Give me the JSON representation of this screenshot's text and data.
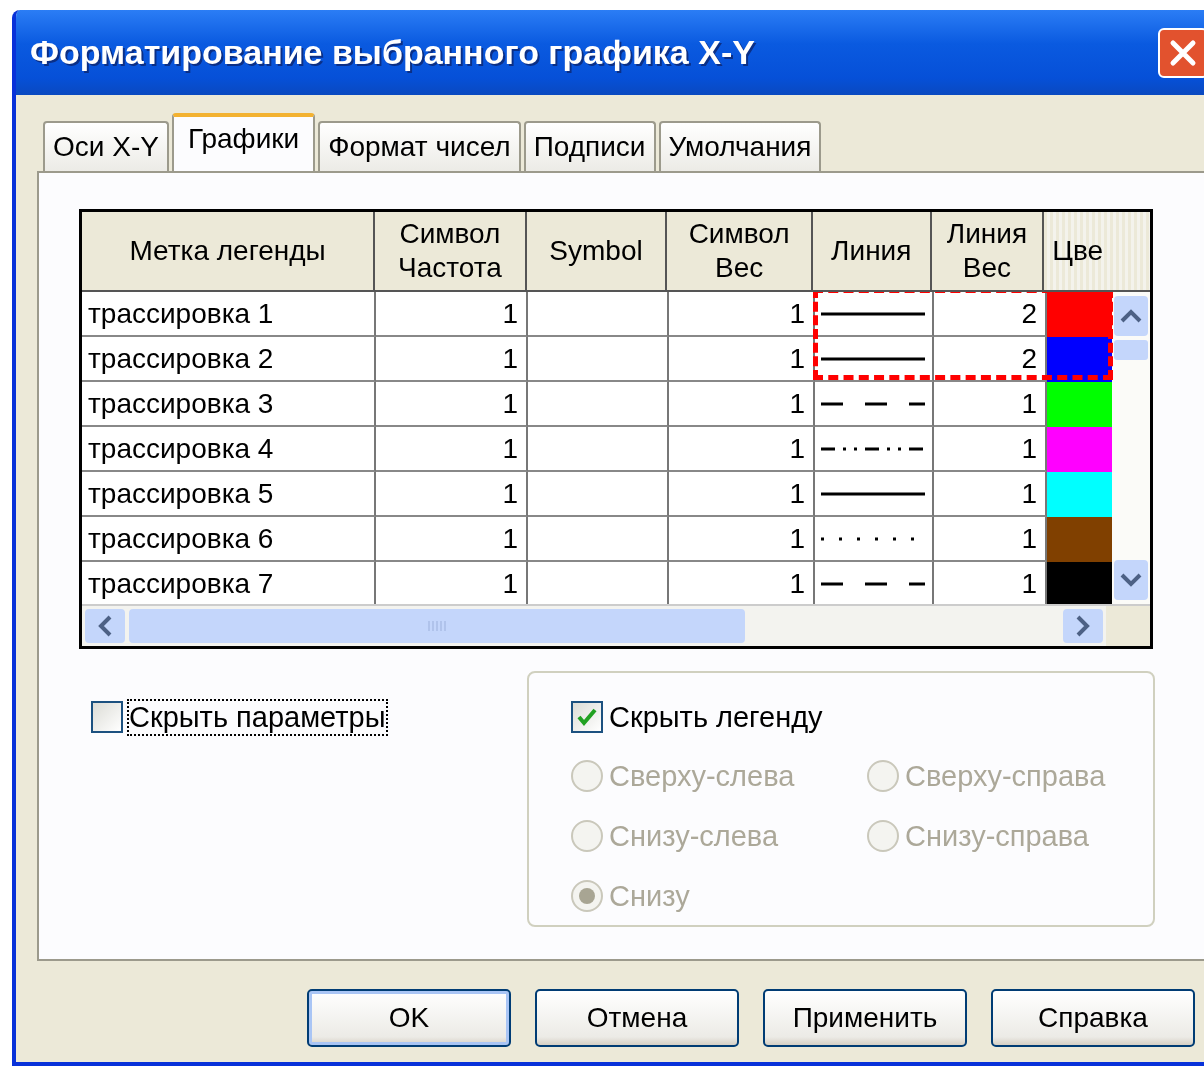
{
  "window": {
    "title": "Форматирование выбранного графика X-Y"
  },
  "tabs": [
    {
      "label": "Оси X-Y",
      "selected": false
    },
    {
      "label": "Графики",
      "selected": true
    },
    {
      "label": "Формат чисел",
      "selected": false
    },
    {
      "label": "Подписи",
      "selected": false
    },
    {
      "label": "Умолчания",
      "selected": false
    }
  ],
  "table": {
    "columns": [
      "Метка легенды",
      "Символ Частота",
      "Symbol",
      "Символ Вес",
      "Линия",
      "Линия Вес",
      "Цве"
    ],
    "rows": [
      {
        "label": "трассировка 1",
        "symbol_frequency": "1",
        "symbol_weight": "1",
        "kind": "solid",
        "line_weight": "2",
        "color": "#ff0000",
        "highlighted": true
      },
      {
        "label": "трассировка 2",
        "symbol_frequency": "1",
        "symbol_weight": "1",
        "kind": "solid",
        "line_weight": "2",
        "color": "#0000ff",
        "highlighted": true
      },
      {
        "label": "трассировка 3",
        "symbol_frequency": "1",
        "symbol_weight": "1",
        "kind": "dash",
        "line_weight": "1",
        "color": "#00ff00",
        "highlighted": false
      },
      {
        "label": "трассировка 4",
        "symbol_frequency": "1",
        "symbol_weight": "1",
        "kind": "dash-dot-dot",
        "line_weight": "1",
        "color": "#ff00ff",
        "highlighted": false
      },
      {
        "label": "трассировка 5",
        "symbol_frequency": "1",
        "symbol_weight": "1",
        "kind": "solid",
        "line_weight": "1",
        "color": "#00ffff",
        "highlighted": false
      },
      {
        "label": "трассировка 6",
        "symbol_frequency": "1",
        "symbol_weight": "1",
        "kind": "dot",
        "line_weight": "1",
        "color": "#804000",
        "highlighted": false
      },
      {
        "label": "трассировка 7",
        "symbol_frequency": "1",
        "symbol_weight": "1",
        "kind": "dash",
        "line_weight": "1",
        "color": "#000000",
        "highlighted": false
      }
    ]
  },
  "hide_params": {
    "label": "Скрыть параметры",
    "checked": false,
    "focused": true
  },
  "legend": {
    "hide_legend": {
      "label": "Скрыть легенду",
      "checked": true
    },
    "positions": [
      {
        "label": "Сверху-слева",
        "selected": false,
        "disabled": true
      },
      {
        "label": "Сверху-справа",
        "selected": false,
        "disabled": true
      },
      {
        "label": "Снизу-слева",
        "selected": false,
        "disabled": true
      },
      {
        "label": "Снизу-справа",
        "selected": false,
        "disabled": true
      },
      {
        "label": "Снизу",
        "selected": true,
        "disabled": true
      }
    ]
  },
  "buttons": [
    {
      "label": "OK",
      "default": true
    },
    {
      "label": "Отмена",
      "default": false
    },
    {
      "label": "Применить",
      "default": false
    },
    {
      "label": "Справка",
      "default": false
    }
  ]
}
